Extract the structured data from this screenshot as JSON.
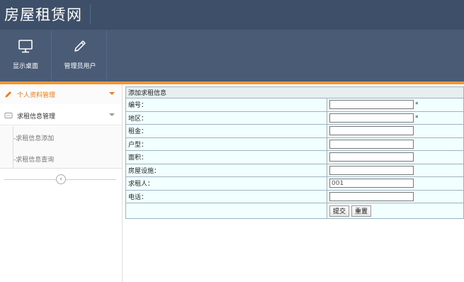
{
  "app": {
    "title": "房屋租赁网"
  },
  "toolbar": {
    "items": [
      {
        "label": "显示桌面",
        "icon": "monitor-icon"
      },
      {
        "label": "管理员用户",
        "icon": "pencil-icon"
      }
    ]
  },
  "colors": {
    "header": "#3e4f69",
    "toolbar": "#4a5b75",
    "accent": "#f29634",
    "active_text": "#f07a1c",
    "form_bg": "#f2ffff",
    "form_border": "#9fb2c2"
  },
  "sidebar": {
    "items": [
      {
        "label": "个人资料管理",
        "icon": "pencil-icon",
        "active": true
      },
      {
        "label": "求租信息管理",
        "icon": "card-icon",
        "active": false
      }
    ],
    "subitems": [
      {
        "label": "-求租信息添加"
      },
      {
        "label": "-求租信息查询"
      }
    ],
    "collapse_glyph": "‹"
  },
  "form": {
    "caption": "添加求租信息",
    "fields": [
      {
        "label": "编号：",
        "value": "",
        "required": true
      },
      {
        "label": "地区：",
        "value": "",
        "required": true
      },
      {
        "label": "租金：",
        "value": "",
        "required": false
      },
      {
        "label": "户型：",
        "value": "",
        "required": false
      },
      {
        "label": "面积：",
        "value": "",
        "required": false
      },
      {
        "label": "房屋设施：",
        "value": "",
        "required": false
      },
      {
        "label": "求租人：",
        "value": "001",
        "required": false
      },
      {
        "label": "电话：",
        "value": "",
        "required": false
      }
    ],
    "required_mark": "*",
    "submit_label": "提交",
    "reset_label": "重置"
  }
}
